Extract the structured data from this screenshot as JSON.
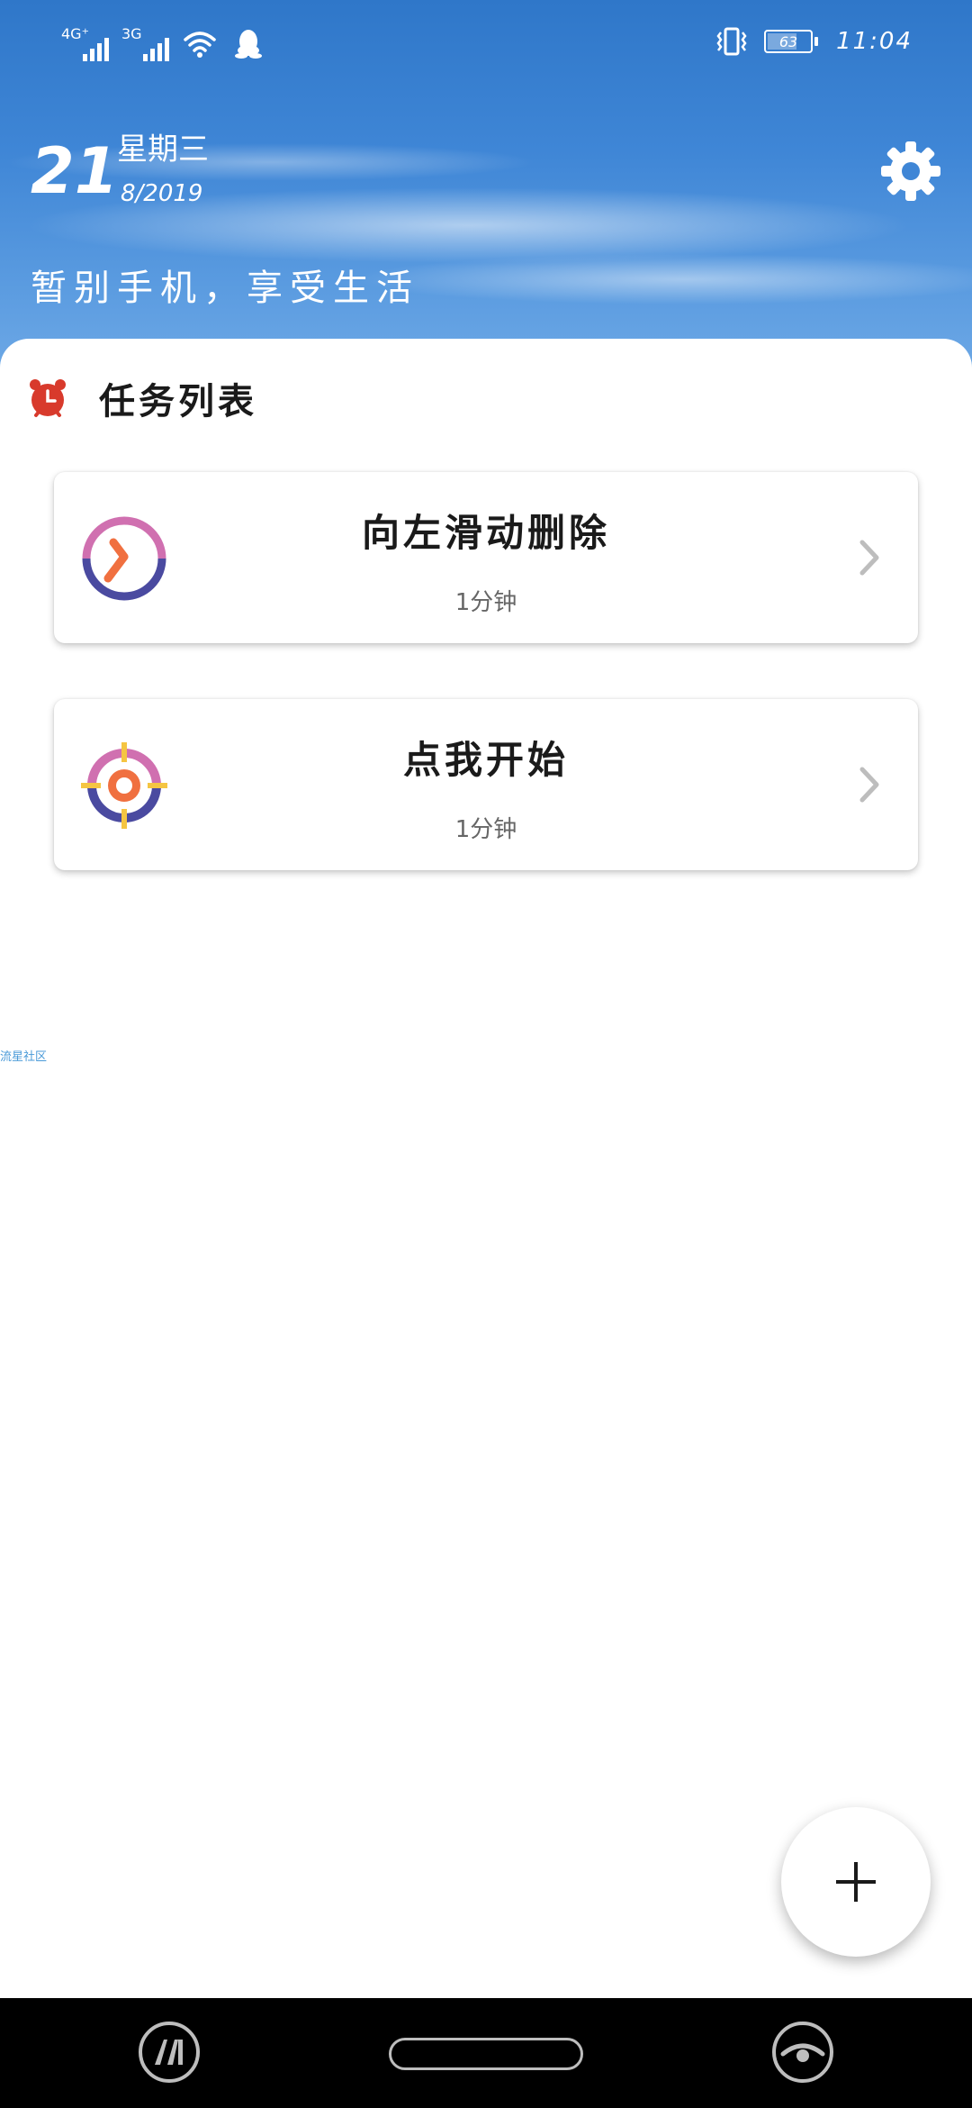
{
  "status_bar": {
    "network_1": "4G⁺",
    "network_2": "3G",
    "battery_percent": "63",
    "battery_level": 0.63,
    "time": "11:04"
  },
  "header": {
    "day": "21",
    "weekday": "星期三",
    "month_year": "8/2019",
    "slogan": "暂别手机，享受生活"
  },
  "task_list": {
    "title": "任务列表",
    "items": [
      {
        "title": "向左滑动删除",
        "duration": "1分钟",
        "icon": "clock-icon"
      },
      {
        "title": "点我开始",
        "duration": "1分钟",
        "icon": "target-icon"
      }
    ]
  },
  "watermark": "流星社区",
  "colors": {
    "sky": "#3f86d6",
    "alarm_red": "#d83a2c",
    "icon_purple": "#4a4aa0",
    "icon_pink": "#d070b0",
    "icon_orange": "#f07040",
    "icon_yellow": "#f5c542"
  }
}
